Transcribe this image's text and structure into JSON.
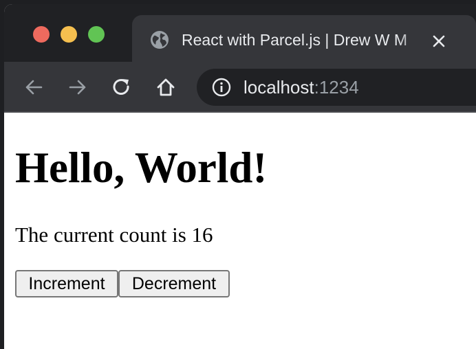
{
  "browser": {
    "tab": {
      "title": "React with Parcel.js | Drew W M",
      "icon": "globe-icon"
    },
    "toolbar": {
      "back_icon": "arrow-left-icon",
      "forward_icon": "arrow-right-icon",
      "reload_icon": "reload-icon",
      "home_icon": "home-icon"
    },
    "address_bar": {
      "host": "localhost",
      "port": ":1234",
      "icon": "info-icon"
    }
  },
  "page": {
    "heading": "Hello, World!",
    "count_text": "The current count is 16",
    "count_value": 16,
    "buttons": {
      "increment_label": "Increment",
      "decrement_label": "Decrement"
    }
  },
  "colors": {
    "traffic_red": "#ee6a5e",
    "traffic_yellow": "#f5bf4f",
    "traffic_green": "#61c454",
    "chrome_dark": "#202124",
    "chrome_tab": "#35363a"
  }
}
